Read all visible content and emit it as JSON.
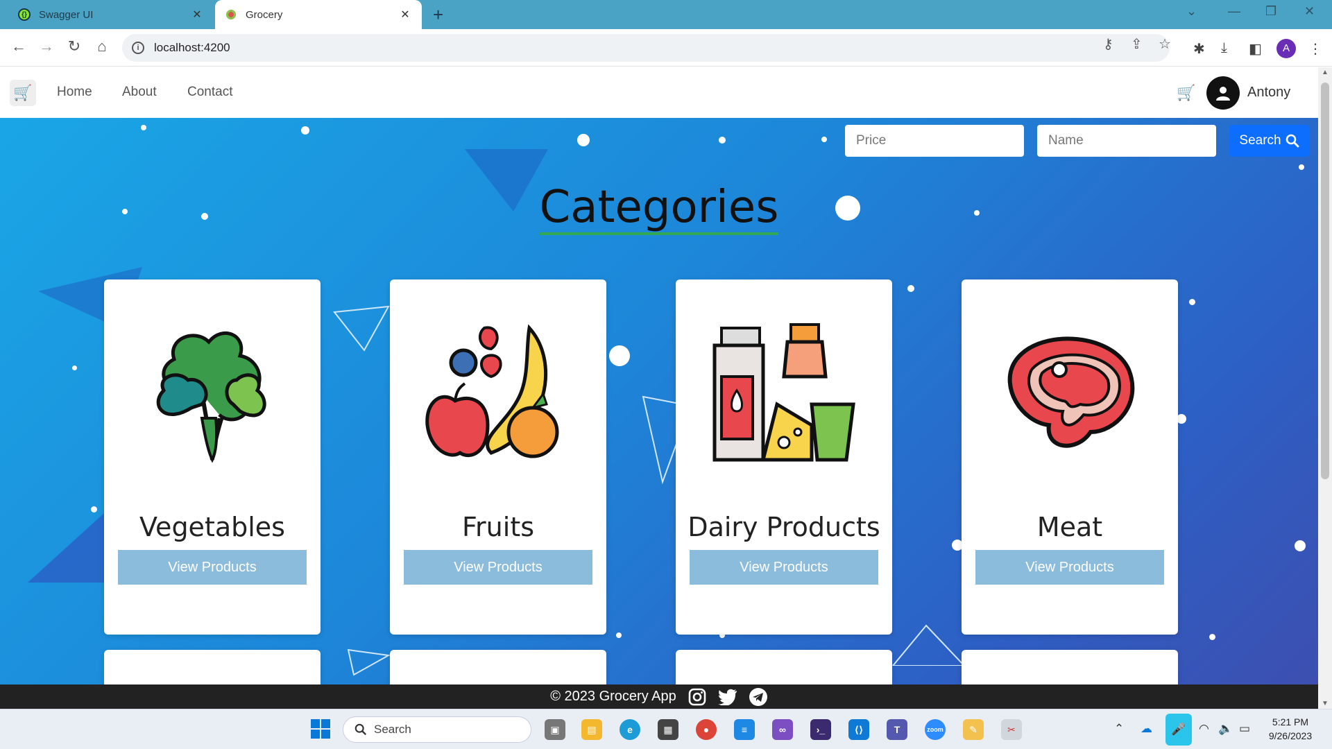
{
  "browser": {
    "tabs": [
      {
        "title": "Swagger UI",
        "favicon": "swagger-icon",
        "active": false
      },
      {
        "title": "Grocery",
        "favicon": "grocery-favicon",
        "active": true
      }
    ],
    "url": "localhost:4200",
    "profile_initial": "A"
  },
  "navbar": {
    "links": [
      "Home",
      "About",
      "Contact"
    ],
    "user_name": "Antony"
  },
  "search": {
    "price_placeholder": "Price",
    "name_placeholder": "Name",
    "button_label": "Search"
  },
  "page": {
    "heading": "Categories"
  },
  "categories": [
    {
      "name": "Vegetables",
      "button": "View Products",
      "icon": "vegetables-icon"
    },
    {
      "name": "Fruits",
      "button": "View Products",
      "icon": "fruits-icon"
    },
    {
      "name": "Dairy Products",
      "button": "View Products",
      "icon": "dairy-icon"
    },
    {
      "name": "Meat",
      "button": "View Products",
      "icon": "meat-icon"
    }
  ],
  "footer": {
    "text": "© 2023 Grocery App",
    "social": [
      "instagram-icon",
      "twitter-icon",
      "telegram-icon"
    ]
  },
  "taskbar": {
    "search_label": "Search",
    "time": "5:21 PM",
    "date": "9/26/2023"
  },
  "colors": {
    "accent": "#0d6efd",
    "view_button": "#8cbcdb",
    "heading_underline": "#33a852",
    "footer_bg": "#222222"
  }
}
